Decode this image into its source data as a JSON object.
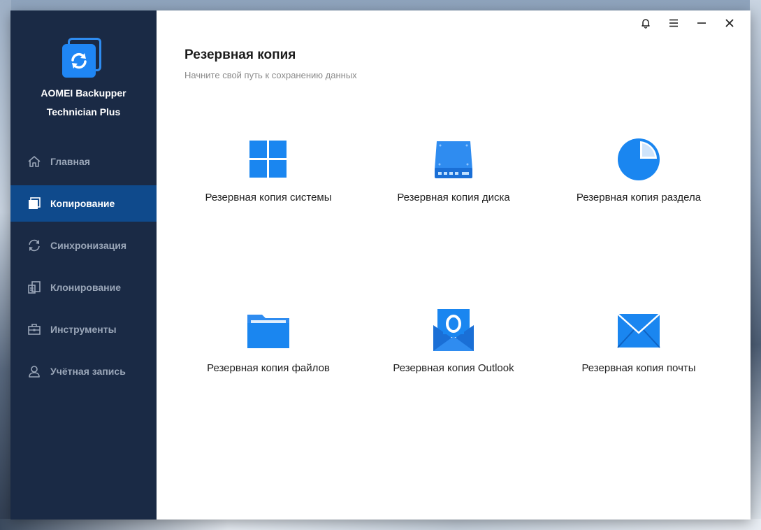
{
  "app": {
    "name": "AOMEI Backupper",
    "edition": "Technician Plus"
  },
  "colors": {
    "sidebar_bg": "#1a2a45",
    "sidebar_active": "#0f4a8c",
    "accent": "#1f86f4"
  },
  "sidebar": {
    "items": [
      {
        "label": "Главная",
        "icon": "home-icon",
        "active": false
      },
      {
        "label": "Копирование",
        "icon": "copy-icon",
        "active": true
      },
      {
        "label": "Синхронизация",
        "icon": "sync-icon",
        "active": false
      },
      {
        "label": "Клонирование",
        "icon": "clone-icon",
        "active": false
      },
      {
        "label": "Инструменты",
        "icon": "toolbox-icon",
        "active": false
      },
      {
        "label": "Учётная запись",
        "icon": "user-icon",
        "active": false
      }
    ]
  },
  "titlebar": {
    "controls": [
      "bell-icon",
      "menu-icon",
      "minimize-icon",
      "close-icon"
    ]
  },
  "main": {
    "title": "Резервная копия",
    "subtitle": "Начните свой путь к сохранению данных",
    "tiles": [
      {
        "label": "Резервная копия системы",
        "icon": "windows-icon"
      },
      {
        "label": "Резервная копия диска",
        "icon": "disk-icon"
      },
      {
        "label": "Резервная копия раздела",
        "icon": "partition-pie-icon"
      },
      {
        "label": "Резервная копия файлов",
        "icon": "folder-icon"
      },
      {
        "label": "Резервная копия Outlook",
        "icon": "outlook-icon"
      },
      {
        "label": "Резервная копия почты",
        "icon": "mail-envelope-icon"
      }
    ]
  }
}
